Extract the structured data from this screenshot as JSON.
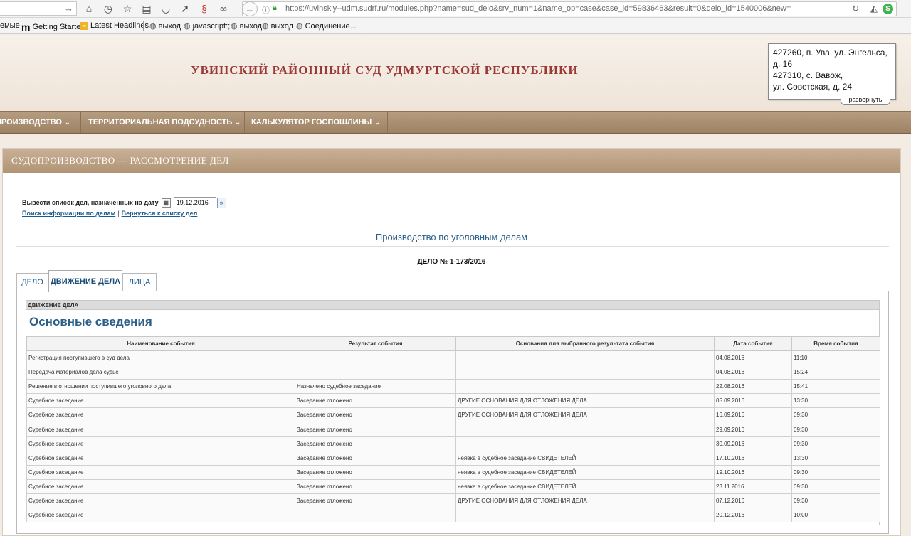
{
  "browser": {
    "url": "https://uvinskiy--udm.sudrf.ru/modules.php?name=sud_delo&srv_num=1&name_op=case&case_id=59836463&result=0&delo_id=1540006&new=",
    "bookmarks": [
      {
        "label": "емые",
        "icon": ""
      },
      {
        "label": "Getting Started",
        "icon": "m-icon"
      },
      {
        "label": "Latest Headlines",
        "icon": "rss-icon"
      },
      {
        "label": "выход",
        "icon": "globe-icon"
      },
      {
        "label": "javascript:;",
        "icon": "globe-icon"
      },
      {
        "label": "выход",
        "icon": "globe-icon"
      },
      {
        "label": "выход",
        "icon": "globe-icon"
      },
      {
        "label": "Соединение...",
        "icon": "globe-icon"
      }
    ]
  },
  "header": {
    "title": "УВИНСКИЙ РАЙОННЫЙ СУД УДМУРТСКОЙ РЕСПУБЛИКИ",
    "address_lines": [
      "427260, п. Ува, ул. Энгельса,",
      "д. 16",
      "427310, с. Вавож,",
      "ул. Советская, д. 24"
    ],
    "expand_label": "развернуть"
  },
  "nav": {
    "items": [
      "ПРОИЗВОДСТВО",
      "ТЕРРИТОРИАЛЬНАЯ ПОДСУДНОСТЬ",
      "КАЛЬКУЛЯТОР ГОСПОШЛИНЫ"
    ]
  },
  "panel": {
    "title": "СУДОПРОИЗВОДСТВО — РАССМОТРЕНИЕ ДЕЛ",
    "date_label": "Вывести список дел, назначенных на дату",
    "date_value": "19.12.2016",
    "link_search": "Поиск информации по делам",
    "link_back": "Вернуться к списку дел",
    "section_title": "Производство по уголовным делам",
    "case_number": "ДЕЛО № 1-173/2016",
    "tabs": [
      "ДЕЛО",
      "ДВИЖЕНИЕ ДЕЛА",
      "ЛИЦА"
    ],
    "inner_header": "ДВИЖЕНИЕ ДЕЛА",
    "inner_title": "Основные сведения",
    "columns": [
      "Наименование события",
      "Результат события",
      "Основания для выбранного результата события",
      "Дата события",
      "Время события"
    ],
    "rows": [
      [
        "Регистрация поступившего в суд дела",
        "",
        "",
        "04.08.2016",
        "11:10"
      ],
      [
        "Передача материалов дела судье",
        "",
        "",
        "04.08.2016",
        "15:24"
      ],
      [
        "Решение в отношении поступившего уголовного дела",
        "Назначено судебное заседание",
        "",
        "22.08.2016",
        "15:41"
      ],
      [
        "Судебное заседание",
        "Заседание отложено",
        "ДРУГИЕ ОСНОВАНИЯ ДЛЯ ОТЛОЖЕНИЯ ДЕЛА",
        "05.09.2016",
        "13:30"
      ],
      [
        "Судебное заседание",
        "Заседание отложено",
        "ДРУГИЕ ОСНОВАНИЯ ДЛЯ ОТЛОЖЕНИЯ ДЕЛА",
        "16.09.2016",
        "09:30"
      ],
      [
        "Судебное заседание",
        "Заседание отложено",
        "",
        "29.09.2016",
        "09:30"
      ],
      [
        "Судебное заседание",
        "Заседание отложено",
        "",
        "30.09.2016",
        "09:30"
      ],
      [
        "Судебное заседание",
        "Заседание отложено",
        "неявка в судебное заседание СВИДЕТЕЛЕЙ",
        "17.10.2016",
        "13:30"
      ],
      [
        "Судебное заседание",
        "Заседание отложено",
        "неявка в судебное заседание СВИДЕТЕЛЕЙ",
        "19.10.2016",
        "09:30"
      ],
      [
        "Судебное заседание",
        "Заседание отложено",
        "неявка в судебное заседание СВИДЕТЕЛЕЙ",
        "23.11.2016",
        "09:30"
      ],
      [
        "Судебное заседание",
        "Заседание отложено",
        "ДРУГИЕ ОСНОВАНИЯ ДЛЯ ОТЛОЖЕНИЯ ДЕЛА",
        "07.12.2016",
        "09:30"
      ],
      [
        "Судебное заседание",
        "",
        "",
        "20.12.2016",
        "10:00"
      ]
    ]
  }
}
